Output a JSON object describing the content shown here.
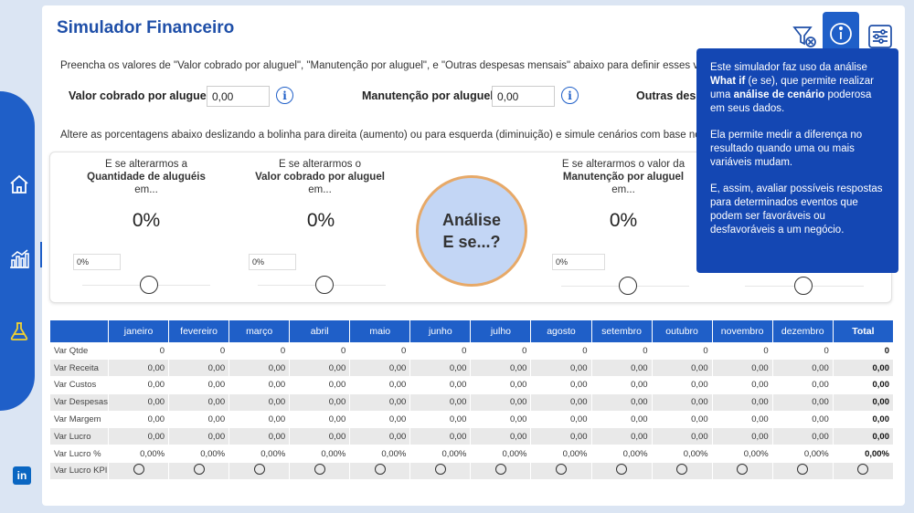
{
  "app_title": "Simulador Financeiro",
  "instructions": {
    "line1": "Preencha os valores de \"Valor cobrado por aluguel\", \"Manutenção por aluguel\", e \"Outras despesas mensais\" abaixo para definir esses valores e",
    "line2": "Altere as porcentagens abaixo deslizando a bolinha para direita (aumento) ou para esquerda (diminuição) e simule cenários com base nos dados"
  },
  "fields": {
    "valor_label": "Valor cobrado por aluguel:",
    "valor_value": "0,00",
    "manutencao_label": "Manutenção por aluguel:",
    "manutencao_value": "0,00",
    "outras_label": "Outras desp"
  },
  "scenarios": [
    {
      "prefix": "E se alterarmos a",
      "name": "Quantidade de aluguéis",
      "suffix": "em...",
      "pct": "0%",
      "box": "0%"
    },
    {
      "prefix": "E se alterarmos o",
      "name": "Valor cobrado por aluguel",
      "suffix": "em...",
      "pct": "0%",
      "box": "0%"
    },
    {
      "prefix": "E se alterarmos o valor da",
      "name": "Manutenção por aluguel",
      "suffix": "em...",
      "pct": "0%",
      "box": "0%"
    }
  ],
  "analise": {
    "line1": "Análise",
    "line2": "E se...?"
  },
  "table": {
    "columns": [
      "janeiro",
      "fevereiro",
      "março",
      "abril",
      "maio",
      "junho",
      "julho",
      "agosto",
      "setembro",
      "outubro",
      "novembro",
      "dezembro",
      "Total"
    ],
    "rows": [
      {
        "label": "Var Qtde",
        "cells": [
          "0",
          "0",
          "0",
          "0",
          "0",
          "0",
          "0",
          "0",
          "0",
          "0",
          "0",
          "0",
          "0"
        ]
      },
      {
        "label": "Var Receita",
        "cells": [
          "0,00",
          "0,00",
          "0,00",
          "0,00",
          "0,00",
          "0,00",
          "0,00",
          "0,00",
          "0,00",
          "0,00",
          "0,00",
          "0,00",
          "0,00"
        ]
      },
      {
        "label": "Var Custos",
        "cells": [
          "0,00",
          "0,00",
          "0,00",
          "0,00",
          "0,00",
          "0,00",
          "0,00",
          "0,00",
          "0,00",
          "0,00",
          "0,00",
          "0,00",
          "0,00"
        ]
      },
      {
        "label": "Var Despesas",
        "cells": [
          "0,00",
          "0,00",
          "0,00",
          "0,00",
          "0,00",
          "0,00",
          "0,00",
          "0,00",
          "0,00",
          "0,00",
          "0,00",
          "0,00",
          "0,00"
        ]
      },
      {
        "label": "Var Margem",
        "cells": [
          "0,00",
          "0,00",
          "0,00",
          "0,00",
          "0,00",
          "0,00",
          "0,00",
          "0,00",
          "0,00",
          "0,00",
          "0,00",
          "0,00",
          "0,00"
        ]
      },
      {
        "label": "Var Lucro",
        "cells": [
          "0,00",
          "0,00",
          "0,00",
          "0,00",
          "0,00",
          "0,00",
          "0,00",
          "0,00",
          "0,00",
          "0,00",
          "0,00",
          "0,00",
          "0,00"
        ]
      },
      {
        "label": "Var Lucro %",
        "cells": [
          "0,00%",
          "0,00%",
          "0,00%",
          "0,00%",
          "0,00%",
          "0,00%",
          "0,00%",
          "0,00%",
          "0,00%",
          "0,00%",
          "0,00%",
          "0,00%",
          "0,00%"
        ]
      }
    ],
    "kpi_label": "Var Lucro KPI"
  },
  "tooltip": {
    "p1_a": "Este simulador faz uso da análise",
    "p1_b": "What if",
    "p1_c": " (e se), que permite realizar uma ",
    "p1_d": "análise de cenário",
    "p1_e": " poderosa em seus dados.",
    "p2": "Ela permite medir a diferença no resultado quando uma ou mais variáveis mudam.",
    "p3": "E, assim, avaliar possíveis respostas para determinados eventos que podem ser favoráveis ou desfavoráveis a um negócio."
  },
  "linkedin": "in",
  "colors": {
    "brand": "#1f5fc8",
    "tooltip_bg": "#1447b3",
    "analise_fill": "#c3d6f5",
    "analise_border": "#e7a968",
    "title": "#1f4fa8"
  }
}
